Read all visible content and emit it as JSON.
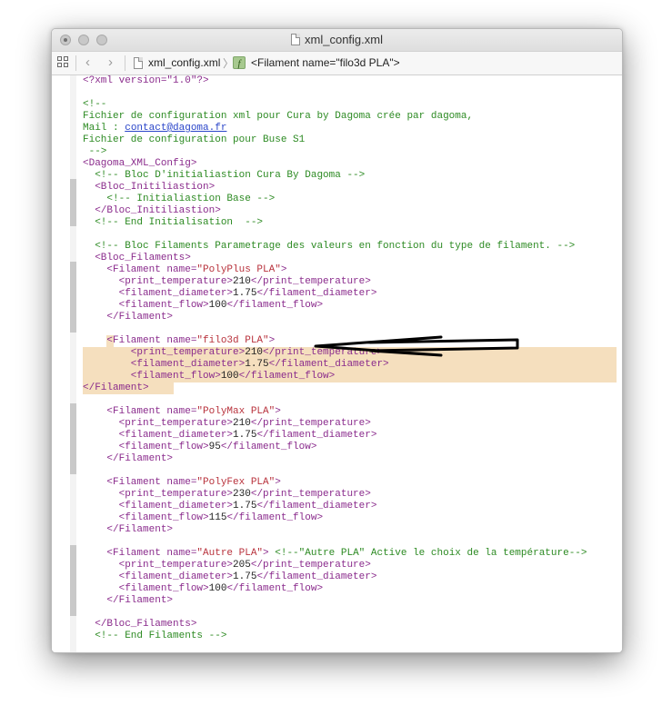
{
  "window": {
    "title": "xml_config.xml"
  },
  "navbar": {
    "file_crumb": "xml_config.xml",
    "function_crumb": "<Filament name=\"filo3d PLA\">",
    "function_icon_label": "f"
  },
  "code": {
    "l1": "<?xml version=\"1.0\"?>",
    "l3": "<!--",
    "l4": "Fichier de configuration xml pour Cura by Dagoma crée par dagoma,",
    "l5_prefix": "Mail : ",
    "l5_link": "contact@dagoma.fr",
    "l6": "Fichier de configuration pour Buse S1",
    "l7": " -->",
    "l8": "<Dagoma_XML_Config>",
    "l9": "  <!-- Bloc D'initialiastion Cura By Dagoma -->",
    "l10": "  <Bloc_Initiliastion>",
    "l11": "    <!-- Initialiastion Base -->",
    "l12": "  </Bloc_Initiliastion>",
    "l13": "  <!-- End Initialisation  -->",
    "l15": "  <!-- Bloc Filaments Parametrage des valeurs en fonction du type de filament. -->",
    "l16": "  <Bloc_Filaments>",
    "f1_open": "    <Filament name=",
    "f1_name": "\"PolyPlus PLA\"",
    "f1_temp_open": "      <print_temperature>",
    "f1_temp": "210",
    "f1_temp_close": "</print_temperature>",
    "f1_diam_open": "      <filament_diameter>",
    "f1_diam": "1.75",
    "f1_diam_close": "</filament_diameter>",
    "f1_flow_open": "      <filament_flow>",
    "f1_flow": "100",
    "f1_flow_close": "</filament_flow>",
    "f_close": "    </Filament>",
    "f2_open": "    <Filament name=",
    "f2_name": "\"filo3d PLA\"",
    "f2_temp_open": "        <print_temperature>",
    "f2_temp": "210",
    "f2_temp_close": "</print_temperature>",
    "f2_diam_open": "        <filament_diameter>",
    "f2_diam": "1.75",
    "f2_diam_close": "</filament_diameter>",
    "f2_flow_open": "        <filament_flow>",
    "f2_flow": "100",
    "f2_flow_close": "</filament_flow>",
    "f2_close": "</Filament>",
    "f3_name": "\"PolyMax PLA\"",
    "f3_temp": "210",
    "f3_diam": "1.75",
    "f3_flow": "95",
    "f4_name": "\"PolyFex PLA\"",
    "f4_temp": "230",
    "f4_diam": "1.75",
    "f4_flow": "115",
    "f5_name": "\"Autre PLA\"",
    "f5_gt": ">",
    "f5_comment": " <!--\"Autre PLA\" Active le choix de la température-->",
    "f5_temp": "205",
    "f5_diam": "1.75",
    "f5_flow": "100",
    "end_bloc": "  </Bloc_Filaments>",
    "end_comment": "  <!-- End Filaments -->",
    "gt": ">"
  },
  "colors": {
    "comment": "#2c8a22",
    "tag": "#8a2b8c",
    "attr_value": "#b8323c",
    "highlight": "#f5dfbe"
  }
}
